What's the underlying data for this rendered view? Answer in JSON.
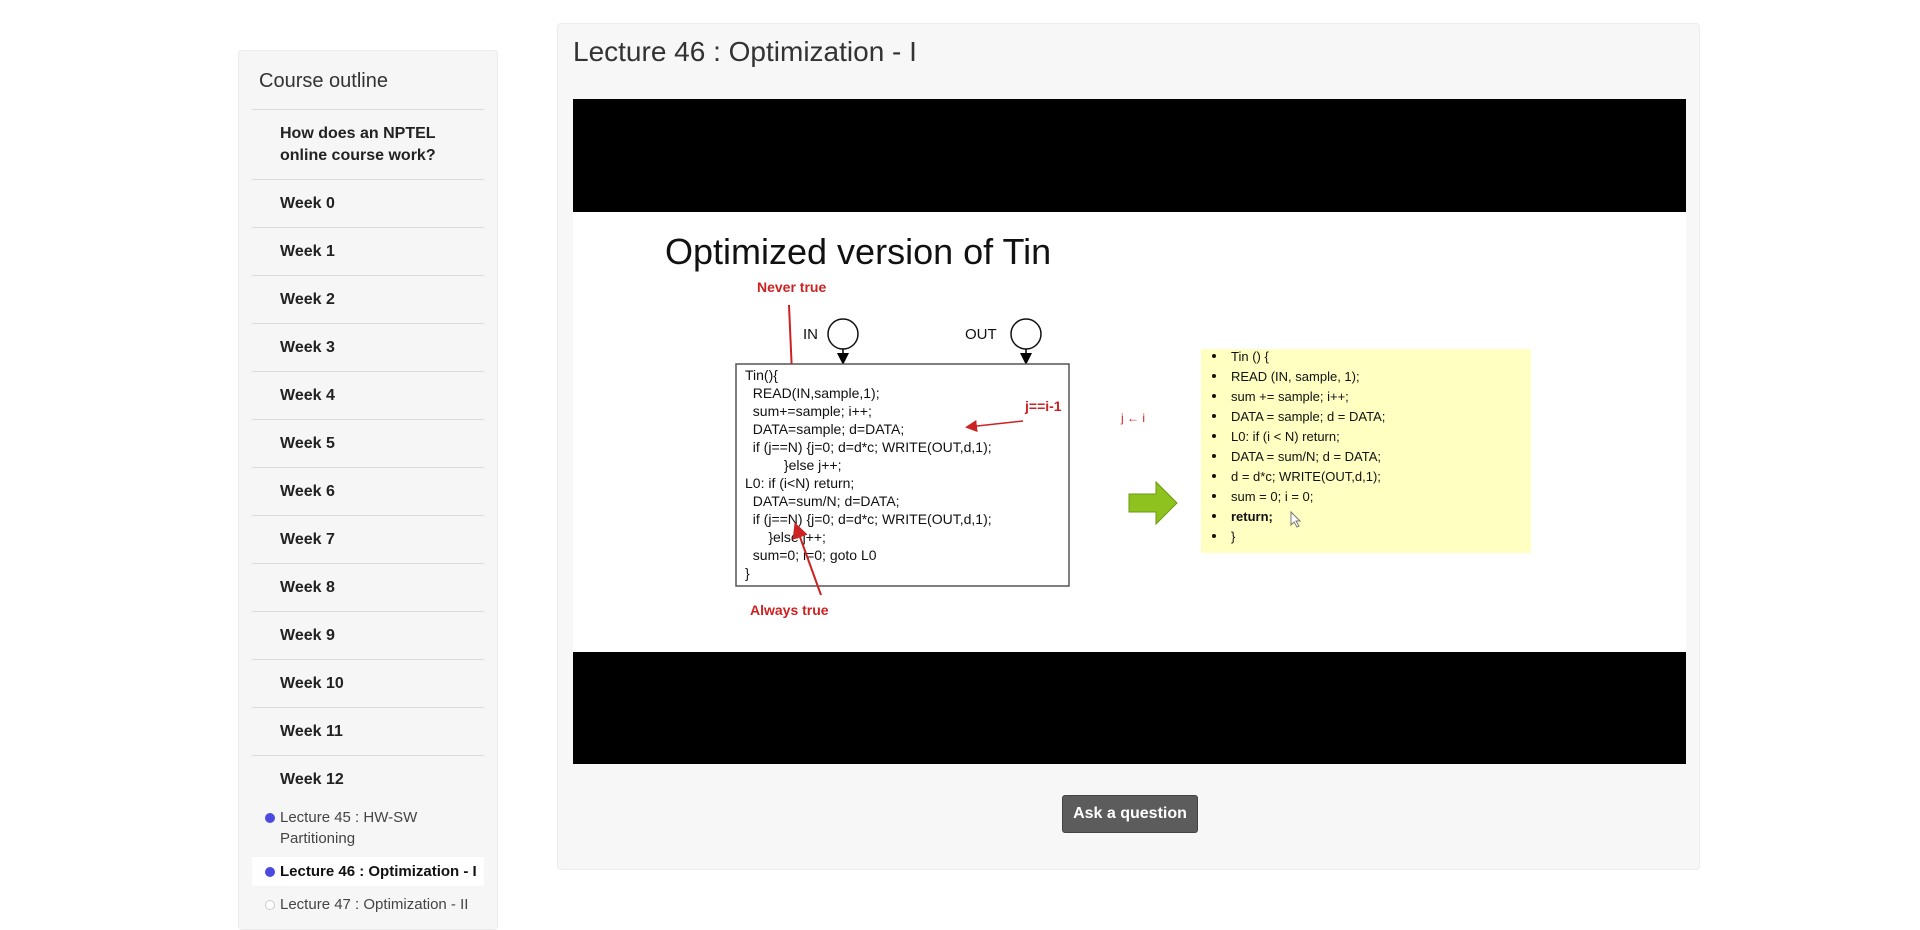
{
  "sidebar": {
    "title": "Course outline",
    "units": [
      {
        "label": "How does an NPTEL online course work?"
      },
      {
        "label": "Week 0"
      },
      {
        "label": "Week 1"
      },
      {
        "label": "Week 2"
      },
      {
        "label": "Week 3"
      },
      {
        "label": "Week 4"
      },
      {
        "label": "Week 5"
      },
      {
        "label": "Week 6"
      },
      {
        "label": "Week 7"
      },
      {
        "label": "Week 8"
      },
      {
        "label": "Week 9"
      },
      {
        "label": "Week 10"
      },
      {
        "label": "Week 11"
      },
      {
        "label": "Week 12"
      }
    ],
    "lessons": [
      {
        "label": "Lecture 45 : HW-SW Partitioning",
        "status": "completed"
      },
      {
        "label": "Lecture 46 : Optimization - I",
        "status": "current"
      },
      {
        "label": "Lecture 47 : Optimization - II",
        "status": "not-started"
      }
    ]
  },
  "main": {
    "title": "Lecture 46 : Optimization - I",
    "ask_label": "Ask a question"
  },
  "slide": {
    "title": "Optimized version of Tin",
    "never_true": "Never true",
    "always_true": "Always true",
    "in_label": "IN",
    "out_label": "OUT",
    "j_eq": "j==i-1",
    "j_sub": "j ← i",
    "code": [
      "Tin(){",
      "  READ(IN,sample,1);",
      "  sum+=sample; i++;",
      "  DATA=sample; d=DATA;",
      "  if (j==N) {j=0; d=d*c; WRITE(OUT,d,1);",
      "          }else j++;",
      "L0: if (i<N) return;",
      "  DATA=sum/N; d=DATA;",
      "  if (j==N) {j=0; d=d*c; WRITE(OUT,d,1);",
      "      }else j++;",
      "  sum=0; i=0; goto L0",
      "}"
    ],
    "optimized": [
      "Tin () {",
      "READ (IN, sample, 1);",
      "sum += sample; i++;",
      "DATA = sample; d = DATA;",
      "L0: if (i < N) return;",
      "DATA = sum/N; d = DATA;",
      "d = d*c; WRITE(OUT,d,1);",
      "sum = 0; i = 0;",
      "return;",
      "}"
    ]
  }
}
